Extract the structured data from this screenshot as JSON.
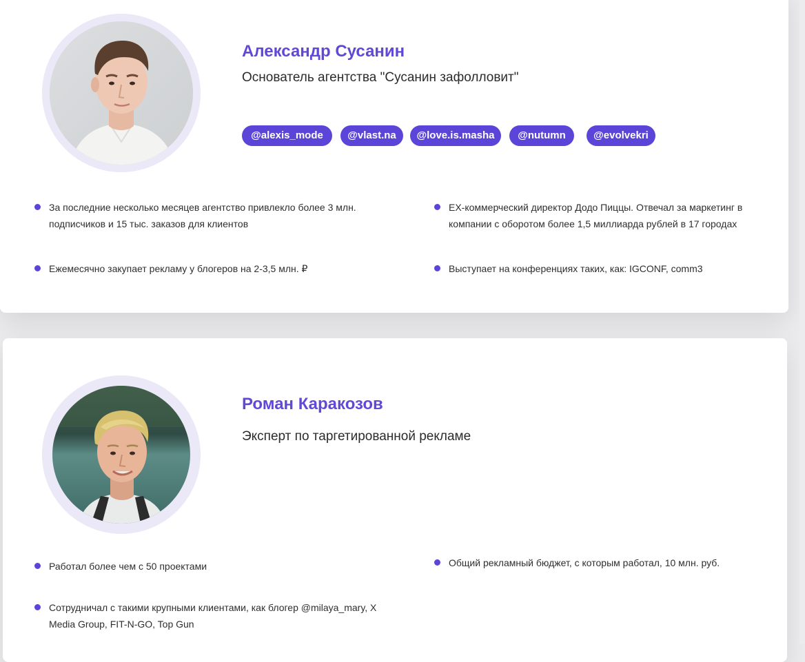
{
  "theme": {
    "accent": "#5b45d9",
    "name_color": "#6248d6",
    "ring_color": "#ebe8f7"
  },
  "experts": [
    {
      "name": "Александр Сусанин",
      "role": "Основатель агентства \"Сусанин зафолловит\"",
      "avatar_icon": "person-photo-icon",
      "tags": [
        "@alexis_mode",
        "@vlast.na",
        "@love.is.masha",
        "@nutumn",
        "@evolvekri"
      ],
      "facts": [
        "За последние несколько месяцев агентство привлекло более 3 млн. подписчиков и 15 тыс. заказов для клиентов",
        "EX-коммерческий директор Додо Пиццы. Отвечал за маркетинг в компании с оборотом более 1,5 миллиарда рублей в 17 городах",
        "Ежемесячно закупает рекламу у блогеров на 2-3,5 млн. ₽",
        "Выступает на конференциях таких, как: IGCONF, comm3"
      ]
    },
    {
      "name": "Роман Каракозов",
      "role": "Эксперт по таргетированной рекламе",
      "avatar_icon": "person-photo-icon",
      "facts": [
        "Работал более чем с 50 проектами",
        "Общий рекламный бюджет, с которым работал, 10 млн. руб.",
        "Сотрудничал с такими крупными клиентами, как блогер @milaya_mary, X Media Group, FIT-N-GO, Top Gun"
      ]
    }
  ]
}
